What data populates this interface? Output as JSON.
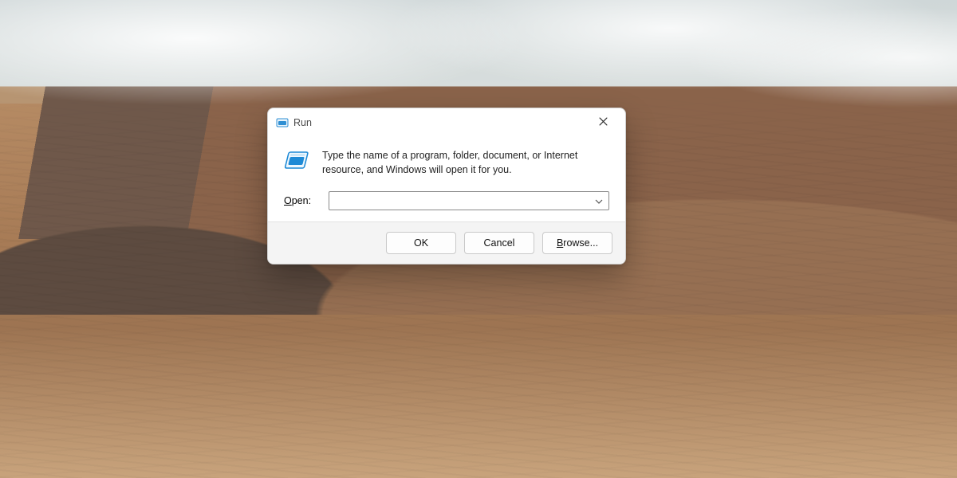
{
  "dialog": {
    "title": "Run",
    "description": "Type the name of a program, folder, document, or Internet resource, and Windows will open it for you.",
    "open_label_underlined": "O",
    "open_label_rest": "pen:",
    "input_value": "",
    "buttons": {
      "ok": "OK",
      "cancel": "Cancel",
      "browse_underlined": "B",
      "browse_rest": "rowse..."
    }
  }
}
